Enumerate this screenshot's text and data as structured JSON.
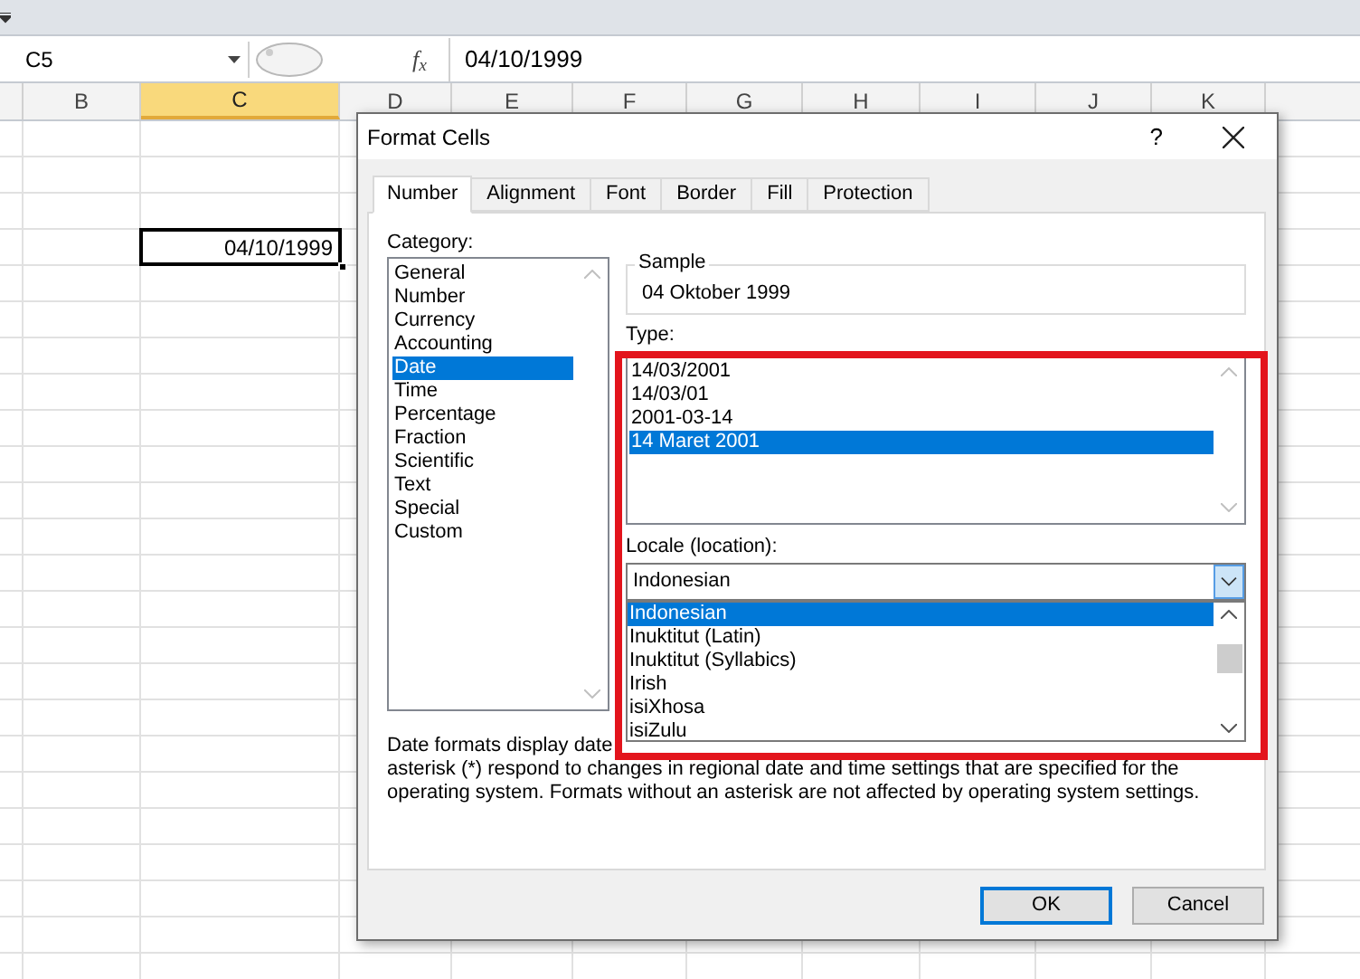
{
  "name_box": "C5",
  "function_label": "f$_{x}$",
  "formula_value": "04/10/1999",
  "columns": [
    {
      "label": "B",
      "selected": false
    },
    {
      "label": "C",
      "selected": true
    },
    {
      "label": "D",
      "selected": false
    },
    {
      "label": "E",
      "selected": false
    },
    {
      "label": "F",
      "selected": false
    },
    {
      "label": "G",
      "selected": false
    },
    {
      "label": "H",
      "selected": false
    },
    {
      "label": "I",
      "selected": false
    },
    {
      "label": "J",
      "selected": false
    },
    {
      "label": "K",
      "selected": false
    }
  ],
  "active_cell": {
    "value": "04/10/1999"
  },
  "dialog": {
    "title": "Format Cells",
    "help": "?",
    "tabs": [
      {
        "label": "Number",
        "selected": true
      },
      {
        "label": "Alignment",
        "selected": false
      },
      {
        "label": "Font",
        "selected": false
      },
      {
        "label": "Border",
        "selected": false
      },
      {
        "label": "Fill",
        "selected": false
      },
      {
        "label": "Protection",
        "selected": false
      }
    ],
    "category": {
      "label": "Category:",
      "items": [
        {
          "label": "General",
          "selected": false
        },
        {
          "label": "Number",
          "selected": false
        },
        {
          "label": "Currency",
          "selected": false
        },
        {
          "label": "Accounting",
          "selected": false
        },
        {
          "label": "Date",
          "selected": true
        },
        {
          "label": "Time",
          "selected": false
        },
        {
          "label": "Percentage",
          "selected": false
        },
        {
          "label": "Fraction",
          "selected": false
        },
        {
          "label": "Scientific",
          "selected": false
        },
        {
          "label": "Text",
          "selected": false
        },
        {
          "label": "Special",
          "selected": false
        },
        {
          "label": "Custom",
          "selected": false
        }
      ]
    },
    "sample": {
      "label": "Sample",
      "value": "04 Oktober 1999"
    },
    "type": {
      "label": "Type:",
      "items": [
        {
          "label": "14/03/2001",
          "selected": false
        },
        {
          "label": "14/03/01",
          "selected": false
        },
        {
          "label": "2001-03-14",
          "selected": false
        },
        {
          "label": "14 Maret 2001",
          "selected": true
        }
      ]
    },
    "locale": {
      "label": "Locale (location):",
      "value": "Indonesian",
      "options": [
        {
          "label": "Indonesian",
          "selected": true
        },
        {
          "label": "Inuktitut (Latin)",
          "selected": false
        },
        {
          "label": "Inuktitut (Syllabics)",
          "selected": false
        },
        {
          "label": "Irish",
          "selected": false
        },
        {
          "label": "isiXhosa",
          "selected": false
        },
        {
          "label": "isiZulu",
          "selected": false
        }
      ]
    },
    "description": [
      "Date formats display date",
      "asterisk (*) respond to changes in regional date and time settings that are specified for the",
      "operating system. Formats without an asterisk are not affected by operating system settings."
    ],
    "buttons": [
      {
        "label": "OK",
        "default": true
      },
      {
        "label": "Cancel",
        "default": false
      }
    ]
  }
}
